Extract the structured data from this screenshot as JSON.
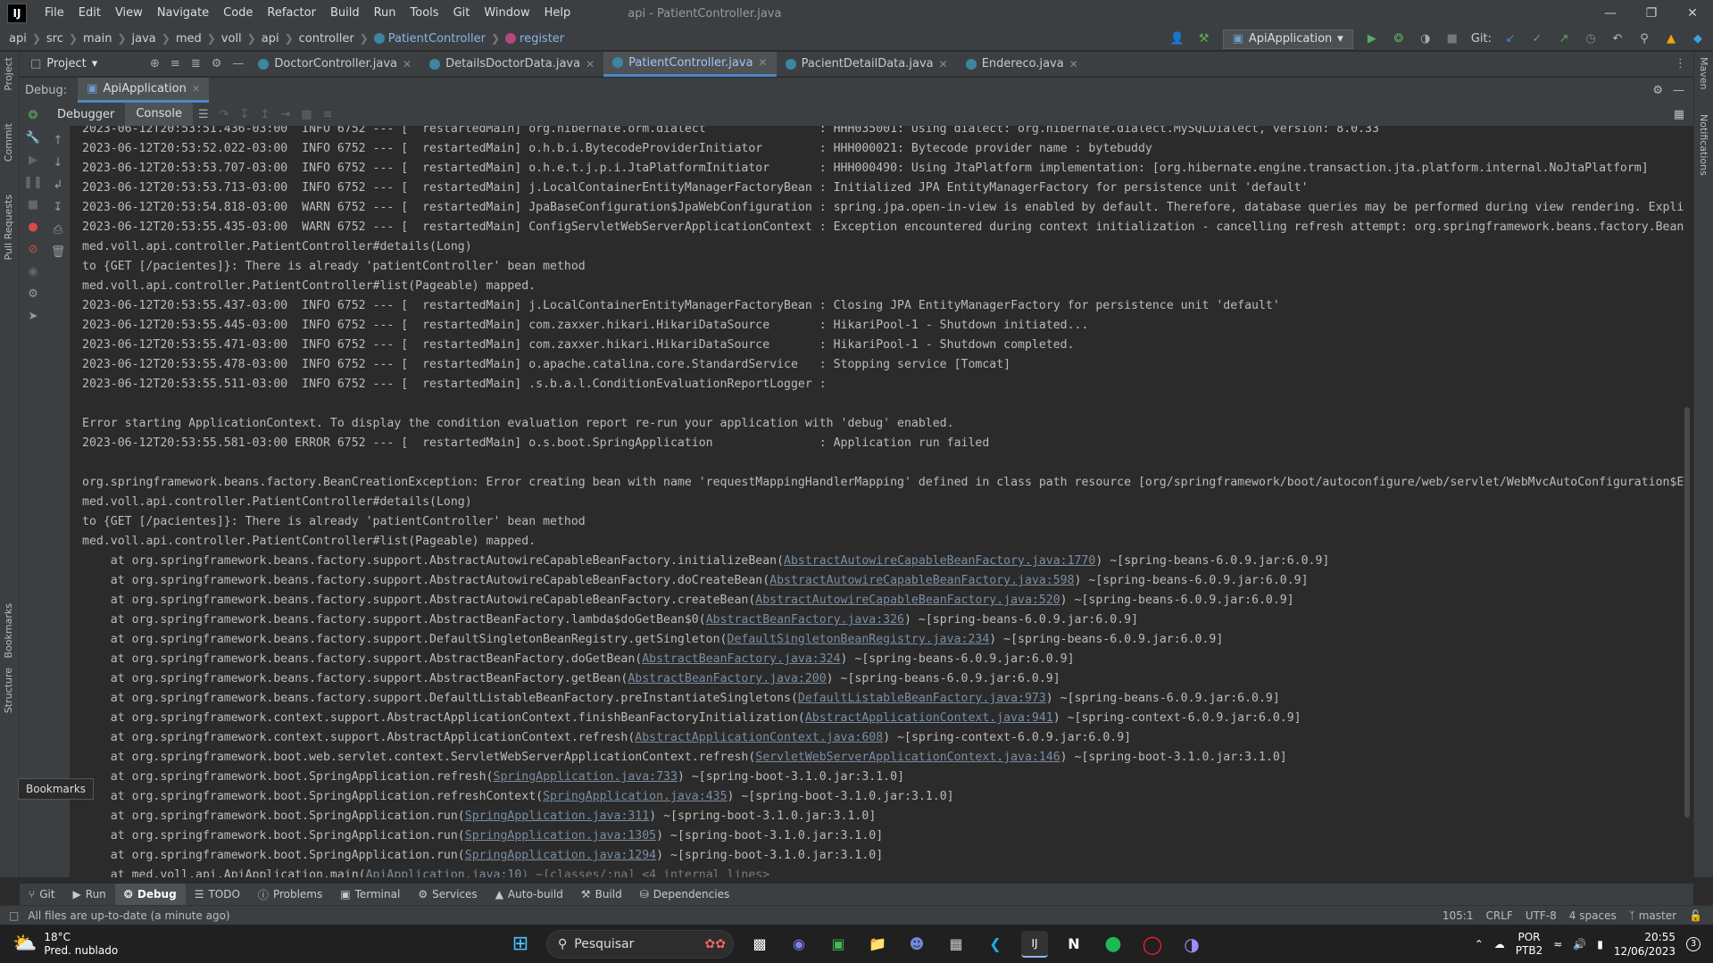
{
  "app": {
    "logo": "IJ",
    "title": "api - PatientController.java",
    "menu": [
      "File",
      "Edit",
      "View",
      "Navigate",
      "Code",
      "Refactor",
      "Build",
      "Run",
      "Tools",
      "Git",
      "Window",
      "Help"
    ]
  },
  "breadcrumb": [
    "api",
    "src",
    "main",
    "java",
    "med",
    "voll",
    "api",
    "controller",
    "PatientController",
    "register"
  ],
  "toolbar": {
    "run_config": "ApiApplication",
    "git_label": "Git:"
  },
  "project_selector": "Project",
  "editor_tabs": [
    {
      "label": "DoctorController.java",
      "active": false
    },
    {
      "label": "DetailsDoctorData.java",
      "active": false
    },
    {
      "label": "PatientController.java",
      "active": true
    },
    {
      "label": "PacientDetailData.java",
      "active": false
    },
    {
      "label": "Endereco.java",
      "active": false
    }
  ],
  "debug": {
    "label": "Debug:",
    "session": "ApiApplication",
    "tabs": [
      "Debugger",
      "Console"
    ]
  },
  "left_strip": [
    "Project",
    "Commit",
    "Pull Requests",
    "Bookmarks",
    "Structure"
  ],
  "right_strip": [
    "Maven",
    "Notifications"
  ],
  "bookmarks_tooltip": "Bookmarks",
  "console_lines": [
    "2023-06-12T20:53:51.436-03:00  INFO 6752 --- [  restartedMain] org.hibernate.orm.dialect                : HHH035001: Using dialect: org.hibernate.dialect.MySQLDialect, version: 8.0.33",
    "2023-06-12T20:53:52.022-03:00  INFO 6752 --- [  restartedMain] o.h.b.i.BytecodeProviderInitiator        : HHH000021: Bytecode provider name : bytebuddy",
    "2023-06-12T20:53:53.707-03:00  INFO 6752 --- [  restartedMain] o.h.e.t.j.p.i.JtaPlatformInitiator       : HHH000490: Using JtaPlatform implementation: [org.hibernate.engine.transaction.jta.platform.internal.NoJtaPlatform]",
    "2023-06-12T20:53:53.713-03:00  INFO 6752 --- [  restartedMain] j.LocalContainerEntityManagerFactoryBean : Initialized JPA EntityManagerFactory for persistence unit 'default'",
    "2023-06-12T20:53:54.818-03:00  WARN 6752 --- [  restartedMain] JpaBaseConfiguration$JpaWebConfiguration : spring.jpa.open-in-view is enabled by default. Therefore, database queries may be performed during view rendering. Expli",
    "2023-06-12T20:53:55.435-03:00  WARN 6752 --- [  restartedMain] ConfigServletWebServerApplicationContext : Exception encountered during context initialization - cancelling refresh attempt: org.springframework.beans.factory.Bean",
    "med.voll.api.controller.PatientController#details(Long)",
    "to {GET [/pacientes]}: There is already 'patientController' bean method",
    "med.voll.api.controller.PatientController#list(Pageable) mapped.",
    "2023-06-12T20:53:55.437-03:00  INFO 6752 --- [  restartedMain] j.LocalContainerEntityManagerFactoryBean : Closing JPA EntityManagerFactory for persistence unit 'default'",
    "2023-06-12T20:53:55.445-03:00  INFO 6752 --- [  restartedMain] com.zaxxer.hikari.HikariDataSource       : HikariPool-1 - Shutdown initiated...",
    "2023-06-12T20:53:55.471-03:00  INFO 6752 --- [  restartedMain] com.zaxxer.hikari.HikariDataSource       : HikariPool-1 - Shutdown completed.",
    "2023-06-12T20:53:55.478-03:00  INFO 6752 --- [  restartedMain] o.apache.catalina.core.StandardService   : Stopping service [Tomcat]",
    "2023-06-12T20:53:55.511-03:00  INFO 6752 --- [  restartedMain] .s.b.a.l.ConditionEvaluationReportLogger :",
    "",
    "Error starting ApplicationContext. To display the condition evaluation report re-run your application with 'debug' enabled.",
    "2023-06-12T20:53:55.581-03:00 ERROR 6752 --- [  restartedMain] o.s.boot.SpringApplication               : Application run failed",
    "",
    "org.springframework.beans.factory.BeanCreationException: Error creating bean with name 'requestMappingHandlerMapping' defined in class path resource [org/springframework/boot/autoconfigure/web/servlet/WebMvcAutoConfiguration$E",
    "med.voll.api.controller.PatientController#details(Long)",
    "to {GET [/pacientes]}: There is already 'patientController' bean method",
    "med.voll.api.controller.PatientController#list(Pageable) mapped."
  ],
  "stack_lines": [
    {
      "pre": "    at org.springframework.beans.factory.support.AbstractAutowireCapableBeanFactory.initializeBean(",
      "link": "AbstractAutowireCapableBeanFactory.java:1770",
      "post": ") ~[spring-beans-6.0.9.jar:6.0.9]"
    },
    {
      "pre": "    at org.springframework.beans.factory.support.AbstractAutowireCapableBeanFactory.doCreateBean(",
      "link": "AbstractAutowireCapableBeanFactory.java:598",
      "post": ") ~[spring-beans-6.0.9.jar:6.0.9]"
    },
    {
      "pre": "    at org.springframework.beans.factory.support.AbstractAutowireCapableBeanFactory.createBean(",
      "link": "AbstractAutowireCapableBeanFactory.java:520",
      "post": ") ~[spring-beans-6.0.9.jar:6.0.9]"
    },
    {
      "pre": "    at org.springframework.beans.factory.support.AbstractBeanFactory.lambda$doGetBean$0(",
      "link": "AbstractBeanFactory.java:326",
      "post": ") ~[spring-beans-6.0.9.jar:6.0.9]"
    },
    {
      "pre": "    at org.springframework.beans.factory.support.DefaultSingletonBeanRegistry.getSingleton(",
      "link": "DefaultSingletonBeanRegistry.java:234",
      "post": ") ~[spring-beans-6.0.9.jar:6.0.9]"
    },
    {
      "pre": "    at org.springframework.beans.factory.support.AbstractBeanFactory.doGetBean(",
      "link": "AbstractBeanFactory.java:324",
      "post": ") ~[spring-beans-6.0.9.jar:6.0.9]"
    },
    {
      "pre": "    at org.springframework.beans.factory.support.AbstractBeanFactory.getBean(",
      "link": "AbstractBeanFactory.java:200",
      "post": ") ~[spring-beans-6.0.9.jar:6.0.9]"
    },
    {
      "pre": "    at org.springframework.beans.factory.support.DefaultListableBeanFactory.preInstantiateSingletons(",
      "link": "DefaultListableBeanFactory.java:973",
      "post": ") ~[spring-beans-6.0.9.jar:6.0.9]"
    },
    {
      "pre": "    at org.springframework.context.support.AbstractApplicationContext.finishBeanFactoryInitialization(",
      "link": "AbstractApplicationContext.java:941",
      "post": ") ~[spring-context-6.0.9.jar:6.0.9]"
    },
    {
      "pre": "    at org.springframework.context.support.AbstractApplicationContext.refresh(",
      "link": "AbstractApplicationContext.java:608",
      "post": ") ~[spring-context-6.0.9.jar:6.0.9]"
    },
    {
      "pre": "    at org.springframework.boot.web.servlet.context.ServletWebServerApplicationContext.refresh(",
      "link": "ServletWebServerApplicationContext.java:146",
      "post": ") ~[spring-boot-3.1.0.jar:3.1.0]"
    },
    {
      "pre": "    at org.springframework.boot.SpringApplication.refresh(",
      "link": "SpringApplication.java:733",
      "post": ") ~[spring-boot-3.1.0.jar:3.1.0]"
    },
    {
      "pre": "    at org.springframework.boot.SpringApplication.refreshContext(",
      "link": "SpringApplication.java:435",
      "post": ") ~[spring-boot-3.1.0.jar:3.1.0]"
    },
    {
      "pre": "    at org.springframework.boot.SpringApplication.run(",
      "link": "SpringApplication.java:311",
      "post": ") ~[spring-boot-3.1.0.jar:3.1.0]"
    },
    {
      "pre": "    at org.springframework.boot.SpringApplication.run(",
      "link": "SpringApplication.java:1305",
      "post": ") ~[spring-boot-3.1.0.jar:3.1.0]"
    },
    {
      "pre": "    at org.springframework.boot.SpringApplication.run(",
      "link": "SpringApplication.java:1294",
      "post": ") ~[spring-boot-3.1.0.jar:3.1.0]"
    },
    {
      "pre": "    at med.voll.api.ApiApplication.main(",
      "link": "ApiApplication.java:10",
      "post": ") ~[classes/:na] <4 internal lines>"
    }
  ],
  "bottom_tabs": [
    {
      "label": "Git",
      "icon": "git-icon",
      "active": false
    },
    {
      "label": "Run",
      "icon": "run-icon",
      "active": false
    },
    {
      "label": "Debug",
      "icon": "debug-icon",
      "active": true
    },
    {
      "label": "TODO",
      "icon": "todo-icon",
      "active": false
    },
    {
      "label": "Problems",
      "icon": "problems-icon",
      "active": false
    },
    {
      "label": "Terminal",
      "icon": "terminal-icon",
      "active": false
    },
    {
      "label": "Services",
      "icon": "services-icon",
      "active": false
    },
    {
      "label": "Auto-build",
      "icon": "auto-build-icon",
      "active": false
    },
    {
      "label": "Build",
      "icon": "build-icon",
      "active": false
    },
    {
      "label": "Dependencies",
      "icon": "dependencies-icon",
      "active": false
    }
  ],
  "status": {
    "message": "All files are up-to-date (a minute ago)",
    "position": "105:1",
    "line_sep": "CRLF",
    "encoding": "UTF-8",
    "indent": "4 spaces",
    "branch": "master"
  },
  "taskbar": {
    "temperature": "18°C",
    "weather": "Pred. nublado",
    "search": "Pesquisar",
    "lang": "POR",
    "layout": "PTB2",
    "time": "20:55",
    "date": "12/06/2023",
    "notif_count": "3"
  },
  "colors": {
    "accent": "#4a88c7",
    "bg": "#2b2b2b",
    "panel": "#3c3f41",
    "link": "#7a8ea2"
  }
}
